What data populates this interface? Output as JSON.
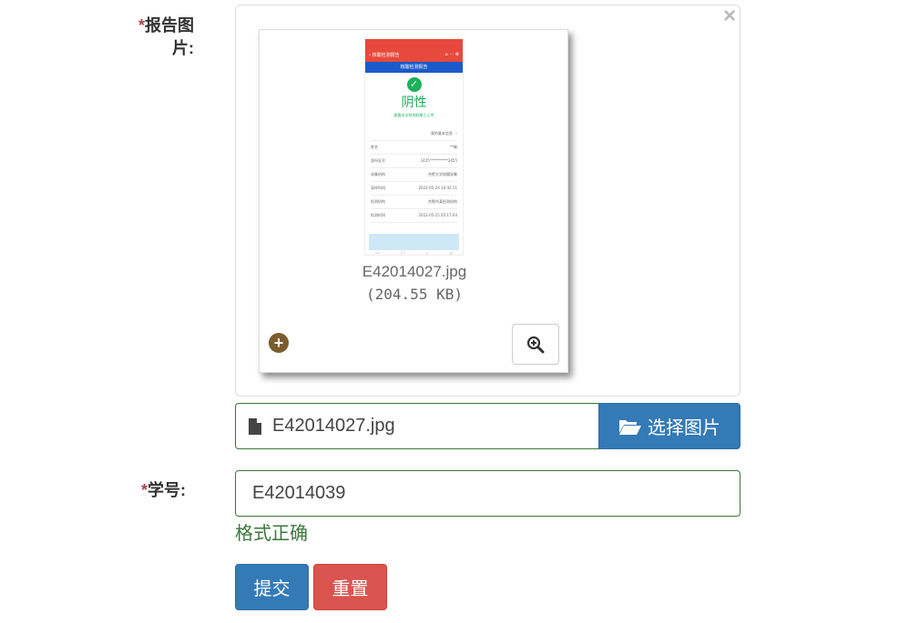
{
  "report_image": {
    "required_mark": "*",
    "label": "报告图片:",
    "remove_icon": "close-icon",
    "preview": {
      "file_name": "E42014027.jpg",
      "file_size": "(204.55 KB)",
      "phone": {
        "app_title": "核酸检测报告",
        "nav_title": "核酸检测报告",
        "result": "阴性",
        "result_note": "查看本次检测结果已上传",
        "rows": [
          {
            "k": "",
            "v": "我的基本信息 ···"
          },
          {
            "k": "姓名",
            "v": "**敏"
          },
          {
            "k": "身份证号",
            "v": "1425**********2455"
          },
          {
            "k": "采集机构",
            "v": "合肥大学核酸采集"
          },
          {
            "k": "采样时间",
            "v": "2022-05-24 16:42:11"
          },
          {
            "k": "检测机构",
            "v": "合肥市某检测机构"
          },
          {
            "k": "检测时间",
            "v": "2022-05-25 02:17:04"
          }
        ]
      }
    },
    "add_icon": "plus-circle-icon",
    "zoom_icon": "zoom-in-icon"
  },
  "file_input": {
    "file_icon": "file-icon",
    "caption": "E42014027.jpg",
    "browse_icon": "folder-open-icon",
    "browse_label": "选择图片"
  },
  "student_id": {
    "required_mark": "*",
    "label": "学号:",
    "value": "E42014039",
    "validation": "格式正确"
  },
  "actions": {
    "submit": "提交",
    "reset": "重置"
  },
  "colors": {
    "primary": "#337ab7",
    "danger": "#d9534f",
    "success": "#3c763d",
    "required": "#a94442"
  }
}
